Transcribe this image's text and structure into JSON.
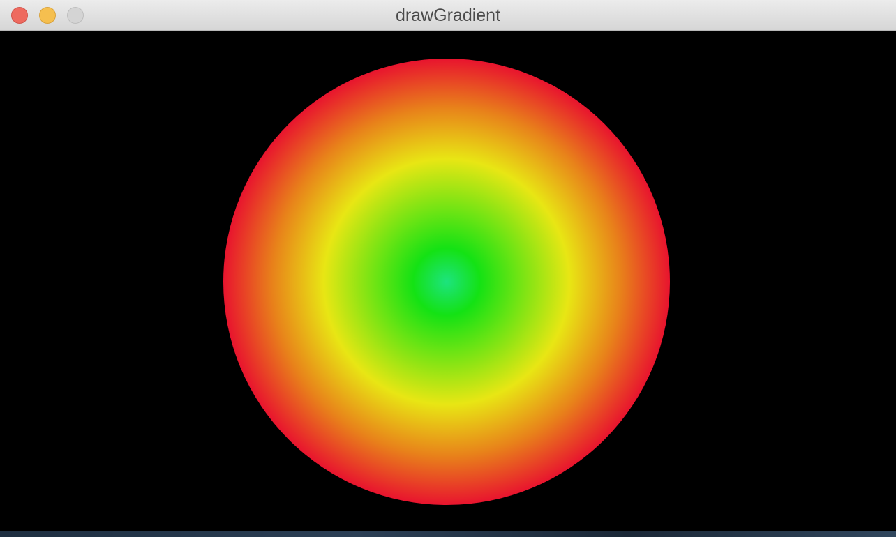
{
  "window": {
    "title": "drawGradient"
  },
  "gradient": {
    "type": "radial",
    "stops": [
      {
        "offset": 0.0,
        "color": "#1de37e"
      },
      {
        "offset": 0.15,
        "color": "#14e214"
      },
      {
        "offset": 0.55,
        "color": "#e8e614"
      },
      {
        "offset": 0.78,
        "color": "#e8821a"
      },
      {
        "offset": 1.0,
        "color": "#e8142e"
      }
    ],
    "background": "#000000"
  }
}
